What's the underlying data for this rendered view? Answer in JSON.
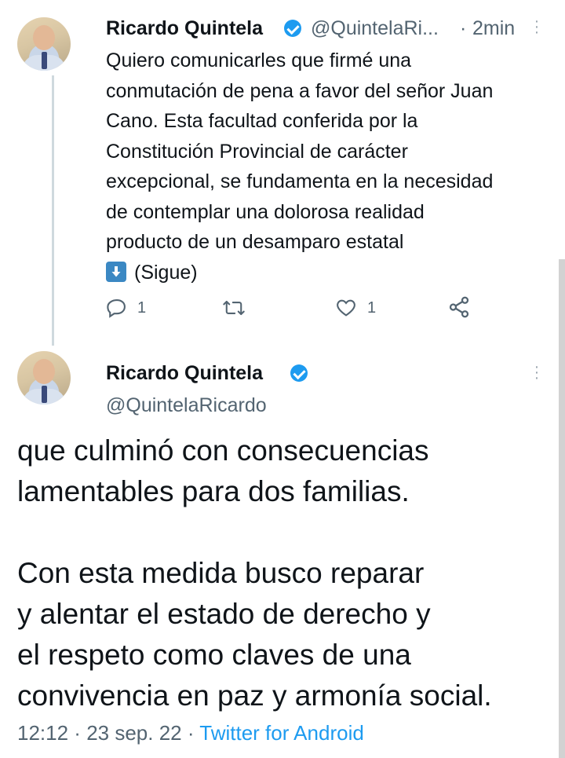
{
  "tweet1": {
    "author_name": "Ricardo Quintela",
    "handle": "@QuintelaRi...",
    "separator": "·",
    "time": "2min",
    "lines": [
      "Quiero comunicarles que firmé una",
      "conmutación de pena a favor del señor Juan",
      "Cano. Esta facultad conferida por la",
      "Constitución Provincial de carácter",
      "excepcional, se fundamenta en la necesidad",
      "de contemplar una dolorosa realidad",
      "producto de un desamparo estatal"
    ],
    "continue_text": "(Sigue)",
    "reply_count": "1",
    "like_count": "1"
  },
  "tweet2": {
    "author_name": "Ricardo Quintela",
    "handle": "@QuintelaRicardo",
    "lines": [
      "que culminó con consecuencias",
      "lamentables para dos familias.",
      "",
      "Con esta medida busco reparar",
      "y alentar el estado de derecho y",
      "el respeto como claves de una",
      "convivencia en paz y armonía social."
    ],
    "time": "12:12",
    "date": "23 sep. 22",
    "source": "Twitter for Android"
  },
  "colors": {
    "verified": "#1d9bf0",
    "link": "#1d9bf0",
    "muted": "#536471",
    "text": "#0f1419"
  },
  "icons": [
    "verified-badge-icon",
    "more-options-icon",
    "reply-icon",
    "retweet-icon",
    "like-icon",
    "share-icon",
    "down-arrow-emoji-icon"
  ]
}
